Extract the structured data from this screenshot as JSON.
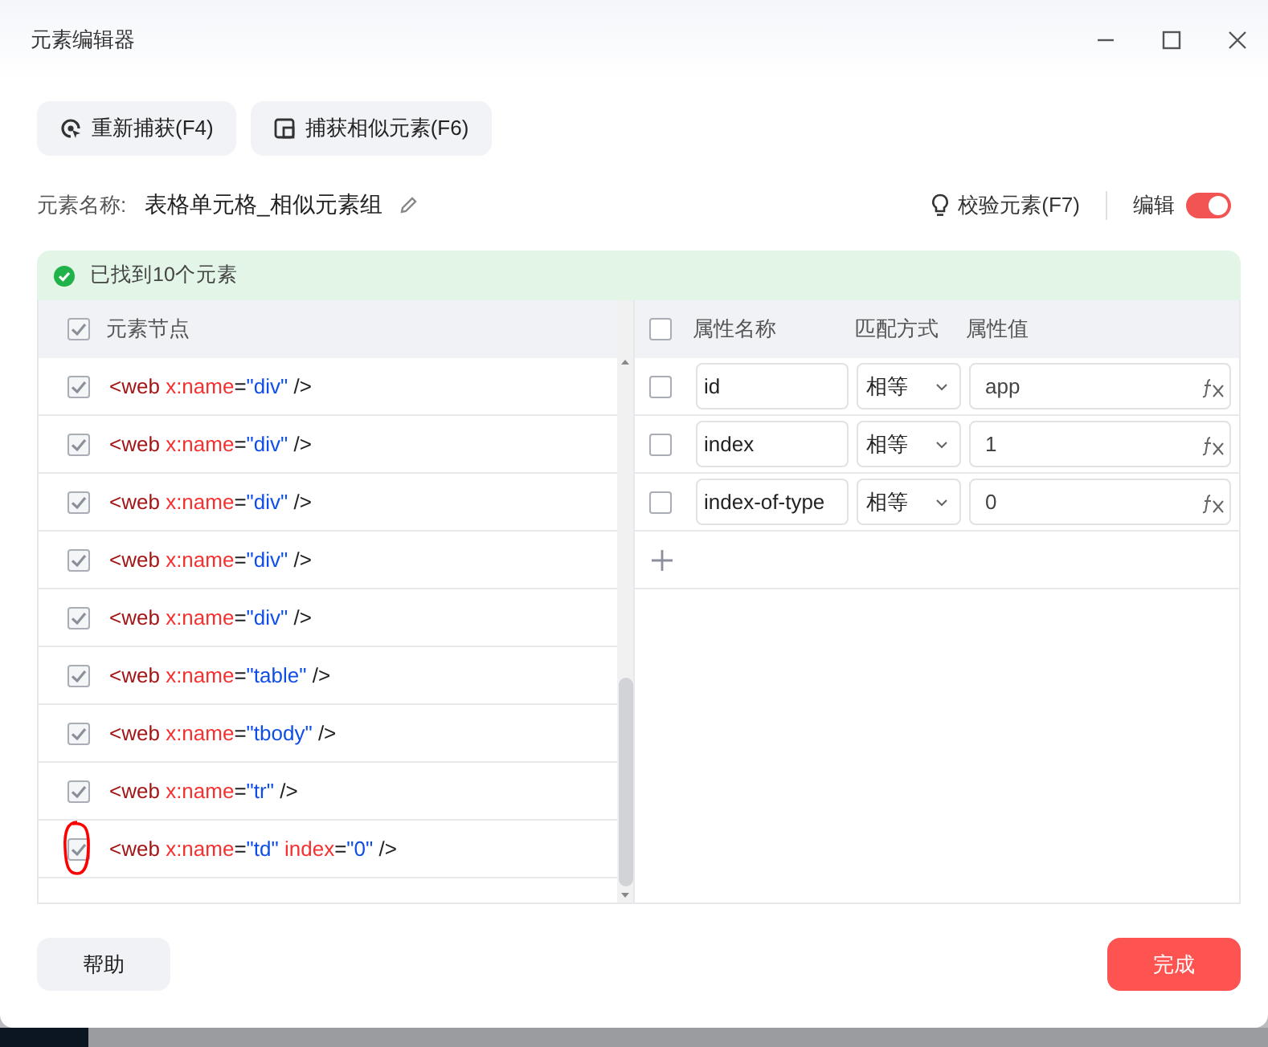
{
  "window": {
    "title": "元素编辑器"
  },
  "toolbar": [
    {
      "label": "重新捕获(F4)",
      "kind": "recapture"
    },
    {
      "label": "捕获相似元素(F6)",
      "kind": "similar"
    }
  ],
  "element_name": {
    "label": "元素名称:",
    "value": "表格单元格_相似元素组"
  },
  "validate_button": "校验元素(F7)",
  "edit_toggle": {
    "label": "编辑",
    "on": true
  },
  "status": "已找到10个元素",
  "nodes": {
    "header": "元素节点",
    "header_checked": true,
    "rows": [
      {
        "checked": true,
        "circled": false,
        "parts": [
          {
            "kind": "tag",
            "text": "<web "
          },
          {
            "kind": "attr",
            "text": "x:name"
          },
          {
            "kind": "op",
            "text": "="
          },
          {
            "kind": "value",
            "text": "\"div\""
          },
          {
            "kind": "op",
            "text": " />"
          }
        ]
      },
      {
        "checked": true,
        "circled": false,
        "parts": [
          {
            "kind": "tag",
            "text": "<web "
          },
          {
            "kind": "attr",
            "text": "x:name"
          },
          {
            "kind": "op",
            "text": "="
          },
          {
            "kind": "value",
            "text": "\"div\""
          },
          {
            "kind": "op",
            "text": " />"
          }
        ]
      },
      {
        "checked": true,
        "circled": false,
        "parts": [
          {
            "kind": "tag",
            "text": "<web "
          },
          {
            "kind": "attr",
            "text": "x:name"
          },
          {
            "kind": "op",
            "text": "="
          },
          {
            "kind": "value",
            "text": "\"div\""
          },
          {
            "kind": "op",
            "text": " />"
          }
        ]
      },
      {
        "checked": true,
        "circled": false,
        "parts": [
          {
            "kind": "tag",
            "text": "<web "
          },
          {
            "kind": "attr",
            "text": "x:name"
          },
          {
            "kind": "op",
            "text": "="
          },
          {
            "kind": "value",
            "text": "\"div\""
          },
          {
            "kind": "op",
            "text": " />"
          }
        ]
      },
      {
        "checked": true,
        "circled": false,
        "parts": [
          {
            "kind": "tag",
            "text": "<web "
          },
          {
            "kind": "attr",
            "text": "x:name"
          },
          {
            "kind": "op",
            "text": "="
          },
          {
            "kind": "value",
            "text": "\"div\""
          },
          {
            "kind": "op",
            "text": " />"
          }
        ]
      },
      {
        "checked": true,
        "circled": false,
        "parts": [
          {
            "kind": "tag",
            "text": "<web "
          },
          {
            "kind": "attr",
            "text": "x:name"
          },
          {
            "kind": "op",
            "text": "="
          },
          {
            "kind": "value",
            "text": "\"table\""
          },
          {
            "kind": "op",
            "text": " />"
          }
        ]
      },
      {
        "checked": true,
        "circled": false,
        "parts": [
          {
            "kind": "tag",
            "text": "<web "
          },
          {
            "kind": "attr",
            "text": "x:name"
          },
          {
            "kind": "op",
            "text": "="
          },
          {
            "kind": "value",
            "text": "\"tbody\""
          },
          {
            "kind": "op",
            "text": " />"
          }
        ]
      },
      {
        "checked": true,
        "circled": false,
        "parts": [
          {
            "kind": "tag",
            "text": "<web "
          },
          {
            "kind": "attr",
            "text": "x:name"
          },
          {
            "kind": "op",
            "text": "="
          },
          {
            "kind": "value",
            "text": "\"tr\""
          },
          {
            "kind": "op",
            "text": " />"
          }
        ]
      },
      {
        "checked": true,
        "circled": true,
        "parts": [
          {
            "kind": "tag",
            "text": "<web "
          },
          {
            "kind": "attr",
            "text": "x:name"
          },
          {
            "kind": "op",
            "text": "="
          },
          {
            "kind": "value",
            "text": "\"td\""
          },
          {
            "kind": "attr",
            "text": " index"
          },
          {
            "kind": "op",
            "text": "="
          },
          {
            "kind": "value",
            "text": "\"0\""
          },
          {
            "kind": "op",
            "text": " />"
          }
        ]
      }
    ]
  },
  "attributes": {
    "header_checked": false,
    "columns": [
      "属性名称",
      "匹配方式",
      "属性值"
    ],
    "rows": [
      {
        "checked": false,
        "name": "id",
        "match": "相等",
        "value": "app"
      },
      {
        "checked": false,
        "name": "index",
        "match": "相等",
        "value": "1"
      },
      {
        "checked": false,
        "name": "index-of-type",
        "match": "相等",
        "value": "0"
      }
    ]
  },
  "help_button": "帮助",
  "done_button": "完成"
}
